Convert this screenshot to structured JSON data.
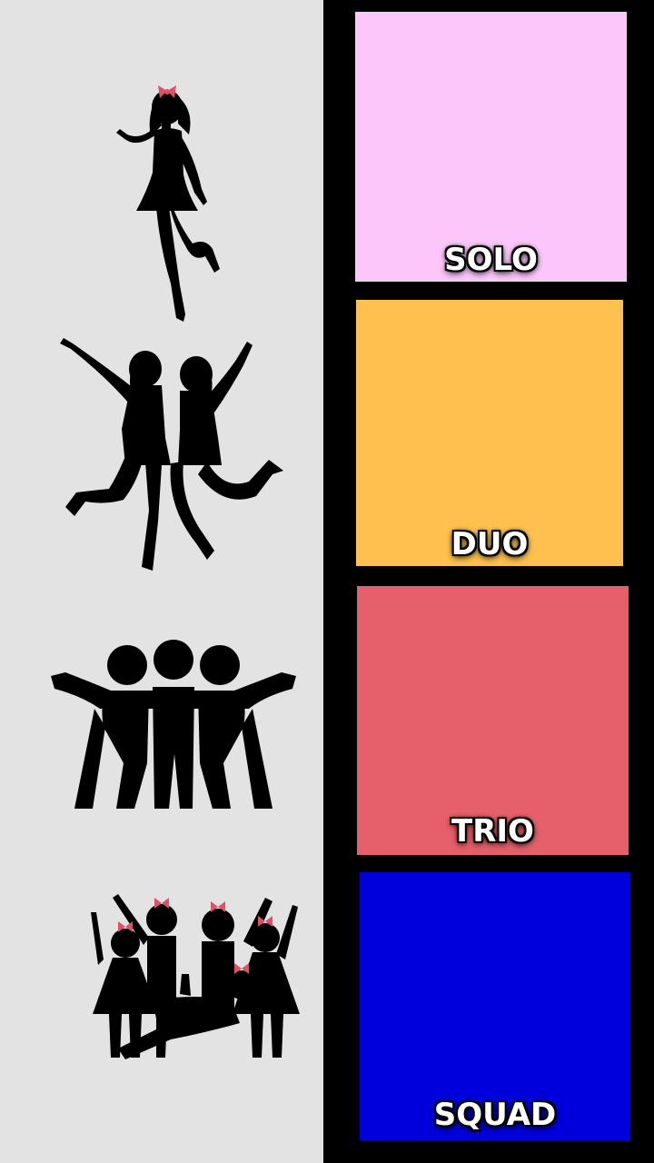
{
  "tiles": [
    {
      "label": "SOLO",
      "color": "#fbc6fa"
    },
    {
      "label": "DUO",
      "color": "#fec14d"
    },
    {
      "label": "TRIO",
      "color": "#e5606a"
    },
    {
      "label": "SQUAD",
      "color": "#0000dc"
    }
  ],
  "colors": {
    "panel": "#e3e3e3",
    "background": "#000000",
    "silhouette": "#000000",
    "bow": "#e0506a"
  },
  "icons": [
    "solo-dancer-icon",
    "duo-dancers-icon",
    "trio-hug-icon",
    "squad-group-icon"
  ]
}
